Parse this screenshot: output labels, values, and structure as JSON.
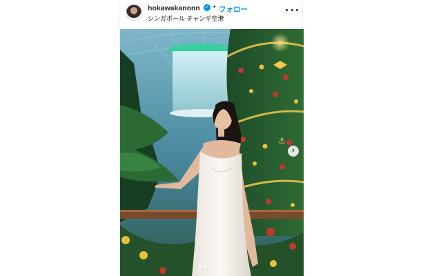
{
  "header": {
    "username": "hokawakanonn",
    "verified_icon": "✓",
    "separator": "•",
    "follow_label": "フォロー",
    "location": "シンガポール チャンギ空港"
  },
  "carousel": {
    "next_icon": "›",
    "total_slides": 6,
    "active_slide": 1
  },
  "colors": {
    "accent": "#0095f6",
    "text": "#262626"
  }
}
